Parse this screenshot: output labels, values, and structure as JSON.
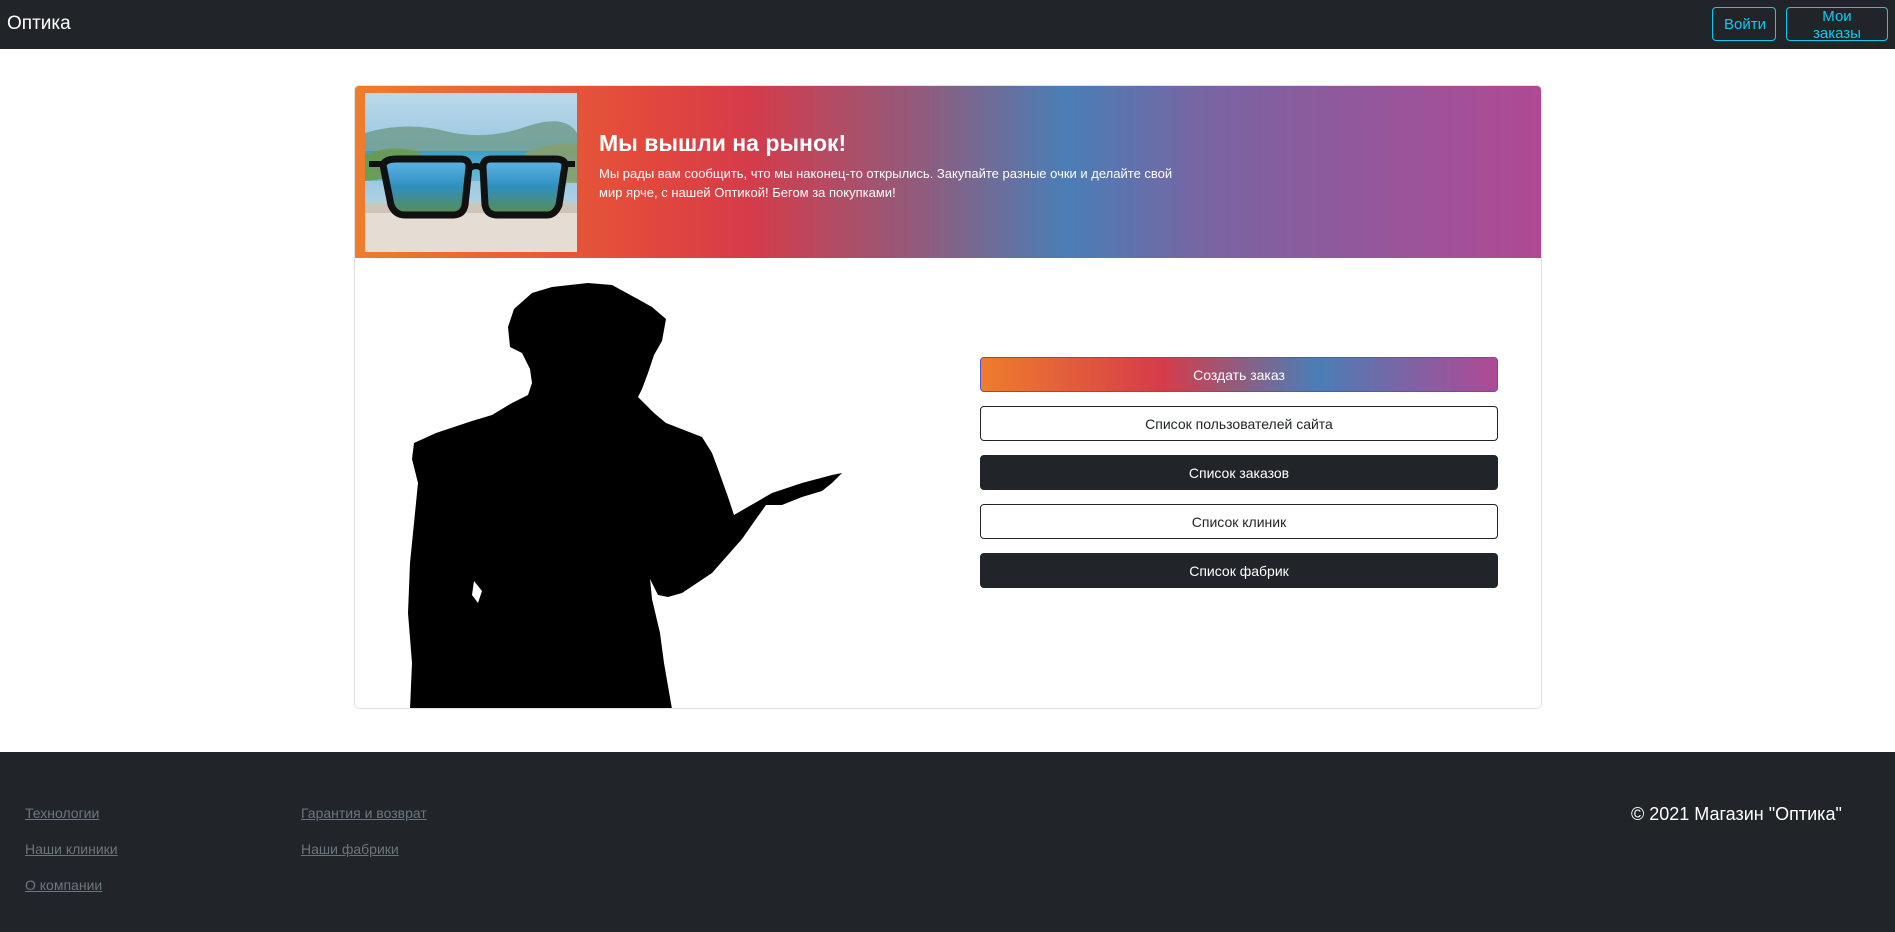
{
  "navbar": {
    "brand": "Оптика",
    "login_label": "Войти",
    "my_orders_label": "Мои заказы",
    "background": "#212529",
    "accent": "#0dcaf0"
  },
  "banner": {
    "title": "Мы вышли на рынок!",
    "text": "Мы рады вам сообщить, что мы наконец-то открылись. Закупайте разные очки и делайте свой мир ярче, с нашей Оптикой! Бегом за покупками!",
    "image_icon": "glasses-landscape-image",
    "gradient_colors": [
      "#ee7d2c",
      "#d63b4a",
      "#4a7eb6",
      "#b04994"
    ]
  },
  "illustration": {
    "icon": "presenter-silhouette-image"
  },
  "actions": {
    "create_order": "Создать заказ",
    "site_users": "Список пользователей сайта",
    "orders_list": "Список заказов",
    "clinics_list": "Список клиник",
    "factories_list": "Список фабрик"
  },
  "footer": {
    "links_col1": [
      "Технологии",
      "Наши клиники",
      "О компании"
    ],
    "links_col2": [
      "Гарантия и возврат",
      "Наши фабрики"
    ],
    "copyright": "© 2021 Магазин \"Оптика\"",
    "background": "#212529",
    "link_color": "#6c757d"
  }
}
